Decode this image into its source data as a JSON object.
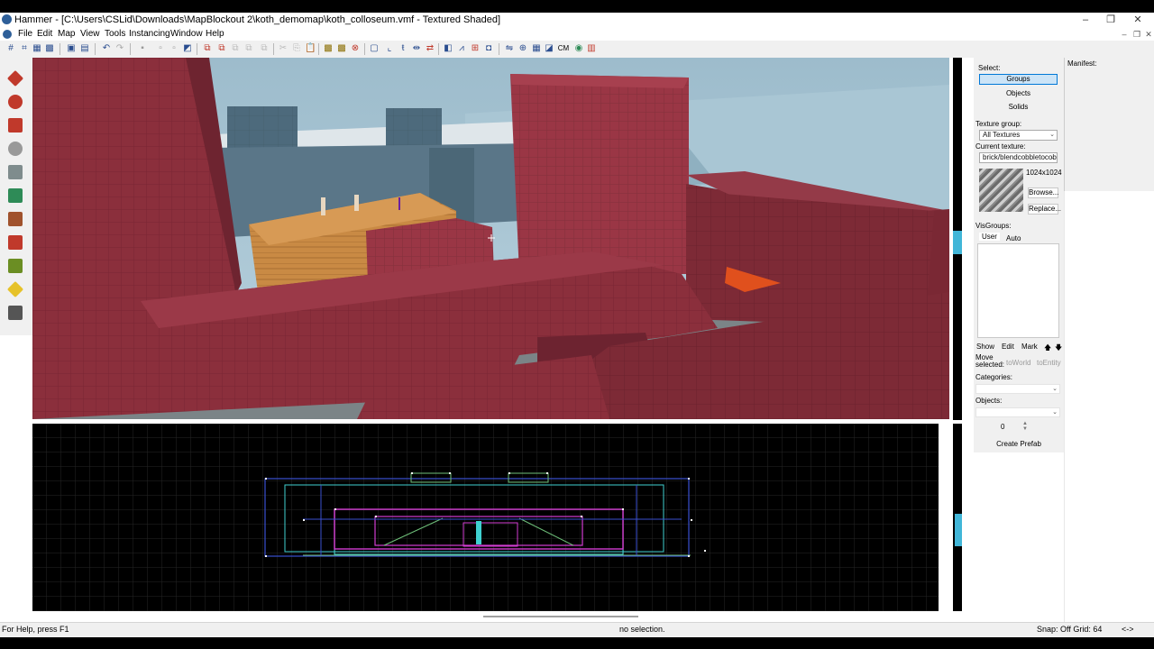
{
  "window": {
    "title": "Hammer - [C:\\Users\\CSLid\\Downloads\\MapBlockout 2\\koth_demomap\\koth_colloseum.vmf - Textured Shaded]",
    "minimize": "–",
    "maximize": "❐",
    "close": "✕"
  },
  "menu": {
    "items": [
      "File",
      "Edit",
      "Map",
      "View",
      "Tools",
      "Instancing",
      "Window",
      "Help"
    ],
    "mdi_min": "–",
    "mdi_restore": "❐",
    "mdi_close": "✕"
  },
  "toolbar": {
    "cm_label": "CM"
  },
  "tools": [
    {
      "name": "selection-tool-icon",
      "color": "#c0392b"
    },
    {
      "name": "magnify-tool-icon",
      "color": "#c0392b"
    },
    {
      "name": "camera-tool-icon",
      "color": "#c0392b"
    },
    {
      "name": "entity-tool-icon",
      "color": "#999999"
    },
    {
      "name": "block-tool-icon",
      "color": "#7f8c8d"
    },
    {
      "name": "texture-tool-icon",
      "color": "#2e8b57"
    },
    {
      "name": "apply-texture-icon",
      "color": "#a0522d"
    },
    {
      "name": "decal-tool-icon",
      "color": "#c0392b"
    },
    {
      "name": "overlay-tool-icon",
      "color": "#6b8e23"
    },
    {
      "name": "clipping-tool-icon",
      "color": "#e6c229"
    },
    {
      "name": "vertex-tool-icon",
      "color": "#555555"
    }
  ],
  "panel": {
    "select_label": "Select:",
    "groups_button": "Groups",
    "objects_button": "Objects",
    "solids_button": "Solids",
    "texture_group_label": "Texture group:",
    "texture_group_value": "All Textures",
    "current_texture_label": "Current texture:",
    "current_texture_value": "brick/blendcobbletocob",
    "texture_size": "1024x1024",
    "browse_button": "Browse...",
    "replace_button": "Replace...",
    "visgroups_label": "VisGroups:",
    "tab_user": "User",
    "tab_auto": "Auto",
    "show_button": "Show",
    "edit_button": "Edit",
    "mark_button": "Mark",
    "up_arrow": "🡅",
    "down_arrow": "🡇",
    "move_selected_label": "Move selected:",
    "to_world_button": "toWorld",
    "to_entity_button": "toEntity",
    "categories_label": "Categories:",
    "objects_label": "Objects:",
    "objects_count": "0",
    "create_prefab_button": "Create Prefab",
    "manifest_label": "Manifest:"
  },
  "status": {
    "help_text": "For Help, press F1",
    "selection_text": "no selection.",
    "snap_text": "Snap: Off Grid: 64",
    "extra_text": "<->"
  },
  "colors": {
    "brick": "#8b2f3c",
    "wood": "#c98a44",
    "sky": "#9fbfd0",
    "grid_line": "#2a2a2a",
    "brush_blue": "#3a4fd0",
    "brush_magenta": "#d23dd2",
    "brush_cyan": "#3fd0d0",
    "brush_green": "#6fc07a"
  }
}
